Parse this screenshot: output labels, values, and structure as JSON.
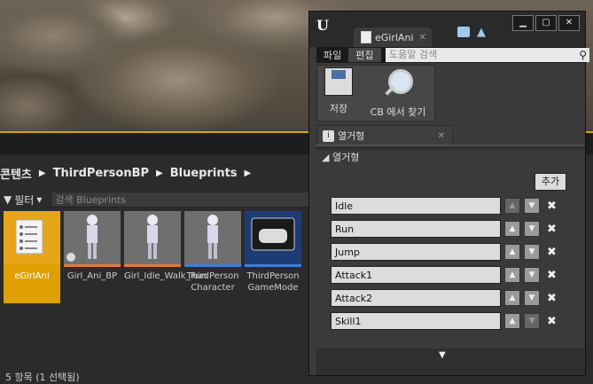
{
  "content_browser": {
    "breadcrumb": [
      "콘텐츠",
      "ThirdPersonBP",
      "Blueprints"
    ],
    "filter_label": "필터",
    "search_placeholder": "검색 Blueprints",
    "assets": [
      {
        "name": "eGirlAni",
        "selected": true,
        "bar_color": "#e0a100"
      },
      {
        "name": "Girl_Ani_BP",
        "selected": false,
        "bar_color": "#e57a3a"
      },
      {
        "name": "Girl_Idle_Walk_Run",
        "selected": false,
        "bar_color": "#e57a3a"
      },
      {
        "name": "ThirdPerson Character",
        "selected": false,
        "bar_color": "#3b7fd9"
      },
      {
        "name": "ThirdPerson GameMode",
        "selected": false,
        "bar_color": "#3b7fd9"
      }
    ],
    "status": "5 항목 (1 선택됨)"
  },
  "editor_window": {
    "tab_title": "eGirlAni",
    "menu": {
      "file": "파일",
      "edit": "편집"
    },
    "help_search_placeholder": "도움말 검색",
    "toolbar": {
      "save_label": "저장",
      "find_label": "CB 에서 찾기"
    },
    "panel_tab": "열거형",
    "category": "열거형",
    "add_label": "추가",
    "enumerators": [
      "Idle",
      "Run",
      "Jump",
      "Attack1",
      "Attack2",
      "Skill1"
    ]
  },
  "colors": {
    "selection": "#e0a100",
    "accent_border": "#d4a400"
  }
}
